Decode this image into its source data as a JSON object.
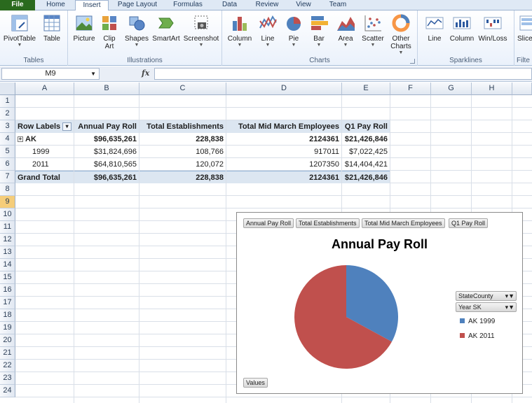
{
  "ribbon_tabs": [
    "File",
    "Home",
    "Insert",
    "Page Layout",
    "Formulas",
    "Data",
    "Review",
    "View",
    "Team"
  ],
  "ribbon_groups": {
    "tables": {
      "label": "Tables",
      "buttons": [
        "PivotTable",
        "Table"
      ]
    },
    "illustrations": {
      "label": "Illustrations",
      "buttons": [
        "Picture",
        "Clip Art",
        "Shapes",
        "SmartArt",
        "Screenshot"
      ]
    },
    "charts": {
      "label": "Charts",
      "buttons": [
        "Column",
        "Line",
        "Pie",
        "Bar",
        "Area",
        "Scatter",
        "Other Charts"
      ]
    },
    "sparklines": {
      "label": "Sparklines",
      "buttons": [
        "Line",
        "Column",
        "Win/Loss"
      ]
    },
    "filter": {
      "label": "Filte",
      "buttons": [
        "Slice"
      ]
    }
  },
  "formula_bar": {
    "name_box": "M9",
    "fx": "fx",
    "value": ""
  },
  "columns": [
    "A",
    "B",
    "C",
    "D",
    "E",
    "F",
    "G",
    "H"
  ],
  "rows": [
    "1",
    "2",
    "3",
    "4",
    "5",
    "6",
    "7",
    "8",
    "9",
    "10",
    "11",
    "12",
    "13",
    "14",
    "15",
    "16",
    "17",
    "18",
    "19",
    "20",
    "21",
    "22",
    "23",
    "24"
  ],
  "pivot": {
    "headers": [
      "Row Labels",
      "Annual Pay Roll",
      "Total Establishments",
      "Total Mid March Employees",
      "Q1 Pay Roll"
    ],
    "rows": [
      {
        "label": "AK",
        "values": [
          "$96,635,261",
          "228,838",
          "2124361",
          "$21,426,846"
        ]
      },
      {
        "label": "1999",
        "values": [
          "$31,824,696",
          "108,766",
          "917011",
          "$7,022,425"
        ]
      },
      {
        "label": "2011",
        "values": [
          "$64,810,565",
          "120,072",
          "1207350",
          "$14,404,421"
        ]
      },
      {
        "label": "Grand Total",
        "values": [
          "$96,635,261",
          "228,838",
          "2124361",
          "$21,426,846"
        ]
      }
    ]
  },
  "chart": {
    "field_buttons": [
      "Annual Pay Roll",
      "Total Establishments",
      "Total Mid March Employees",
      "Q1 Pay Roll"
    ],
    "legend_fields": [
      "StateCounty",
      "Year SK"
    ],
    "values_button": "Values",
    "colors": {
      "AK 1999": "#4f81bd",
      "AK 2011": "#c0504d"
    }
  },
  "chart_data": {
    "type": "pie",
    "title": "Annual Pay Roll",
    "categories": [
      "AK 1999",
      "AK 2011"
    ],
    "values": [
      31824696,
      64810565
    ],
    "legend_position": "right"
  }
}
